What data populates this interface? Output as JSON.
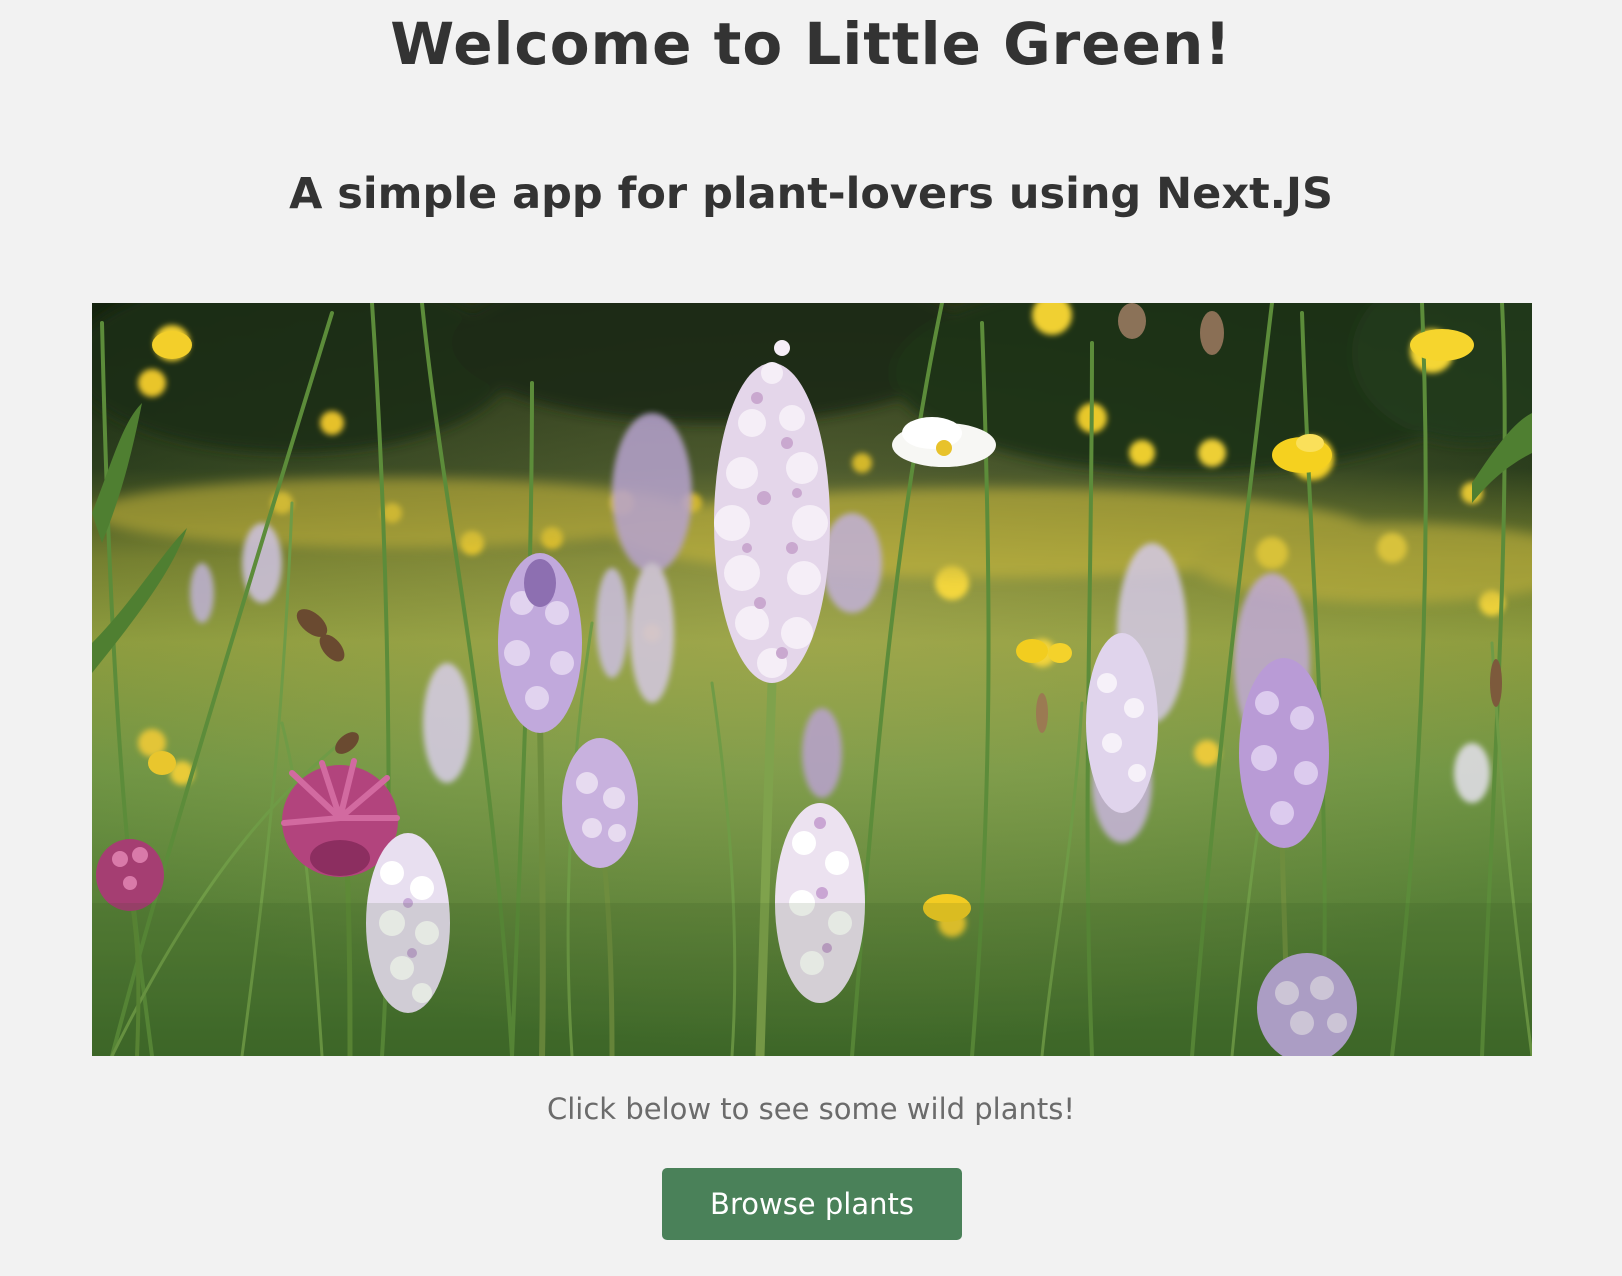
{
  "page": {
    "title": "Welcome to Little Green!",
    "subtitle": "A simple app for plant-lovers using Next.JS"
  },
  "hero": {
    "subject": "wildflower meadow with purple orchids, yellow buttercups, pink clover and white daisy"
  },
  "cta": {
    "caption": "Click below to see some wild plants!",
    "button_label": "Browse plants"
  },
  "colors": {
    "background": "#f2f2f2",
    "text": "#333333",
    "caption_text": "#6b6b6b",
    "button_bg": "#4a8159",
    "button_text": "#ffffff"
  }
}
